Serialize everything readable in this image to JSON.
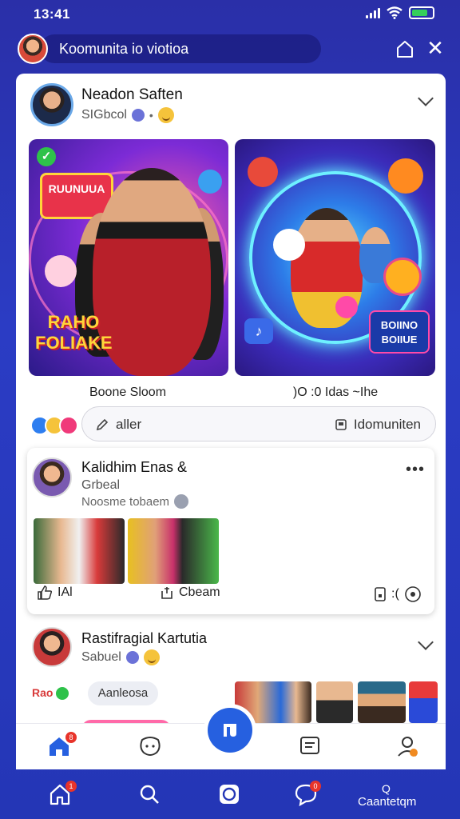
{
  "status_bar": {
    "time": "13:41"
  },
  "top_bar": {
    "title": "Koomunita io viotioa"
  },
  "post1": {
    "author": "Neadon Saften",
    "subtitle": "SIGbcol",
    "media_left": {
      "sticker_top": "RUUNUUA",
      "sticker_bottom": "RAHO FOLIAKE",
      "caption": "Boone Sloom"
    },
    "media_right": {
      "sticker": "BOIINO BOIIUE",
      "caption": ")O :0 Idas ~Ihe"
    },
    "comment_left": "aller",
    "comment_right": "Idomuniten"
  },
  "post2": {
    "author": "Kalidhim Enas &",
    "subtitle": "Grbeal",
    "meta": "Noosme tobaem",
    "like_label": "IAl",
    "share_label": "Cbeam",
    "right_action_label": ":("
  },
  "post3": {
    "author": "Rastifragial Kartutia",
    "subtitle": "Sabuel",
    "label": "Rao",
    "tag_pill": "Aanleosa"
  },
  "bottom_nav": {
    "home_badge": "1",
    "messages_badge": "0",
    "account_top": "Q",
    "account_label": "Caantetqm"
  },
  "inner_tabs": {
    "home_badge": "8"
  },
  "colors": {
    "background": "#2a2fa8",
    "accent": "#2660e0",
    "badge": "#e8342a",
    "card": "#ffffff"
  }
}
